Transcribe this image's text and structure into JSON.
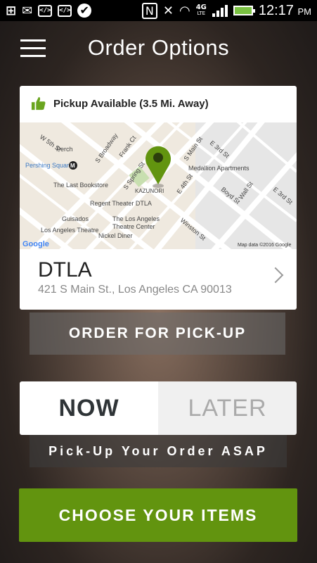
{
  "status_bar": {
    "icons": [
      "plus-box-icon",
      "gmail-icon",
      "code-icon",
      "code-icon",
      "check-chat-icon",
      "nfc-icon",
      "mute-icon",
      "wifi-icon",
      "4g-lte-icon",
      "signal-icon",
      "battery-charging-icon"
    ],
    "network": "4G",
    "network_sub": "LTE",
    "time": "12:17",
    "ampm": "PM"
  },
  "header": {
    "title": "Order Options",
    "menu_icon": "hamburger-menu-icon"
  },
  "location_card": {
    "availability": "Pickup Available (3.5 Mi. Away)",
    "availability_icon": "thumbs-up-icon",
    "map": {
      "labels": {
        "w5th": "W 5th St",
        "perch": "Perch",
        "pershing": "Pershing Square",
        "s_broadway": "S Broadway",
        "frank": "Frank Ct",
        "s_main": "S Main St",
        "e3rd": "E 3rd St",
        "medallion": "Medallion Apartments",
        "bookstore": "The Last Bookstore",
        "s_spring": "S Spring St",
        "kazunori": "KAZUNORI",
        "e4th": "E 4th St",
        "boyd": "Boyd St",
        "wall": "Wall St",
        "e3rd_b": "E 3rd St",
        "regent": "Regent Theater DTLA",
        "guisados": "Guisados",
        "la_theatre": "Los Angeles Theatre",
        "la_theatres_1": "The Los Angeles",
        "la_theatres_2": "Theatre Center",
        "nickel": "Nickel Diner",
        "winston": "Winston St",
        "google": "Google",
        "attribution": "Map data ©2016 Google"
      },
      "pin_color": "#62940f"
    },
    "name": "DTLA",
    "address": "421 S Main St., Los Angeles CA 90013",
    "chevron_icon": "chevron-right-icon"
  },
  "order_mode": "ORDER FOR PICK-UP",
  "timing": {
    "now": "NOW",
    "later": "LATER",
    "selected": "now"
  },
  "asap_text": "Pick-Up Your Order ASAP",
  "cta": "CHOOSE YOUR ITEMS",
  "colors": {
    "accent_green": "#62940f",
    "thumb_green": "#6aa51f"
  }
}
